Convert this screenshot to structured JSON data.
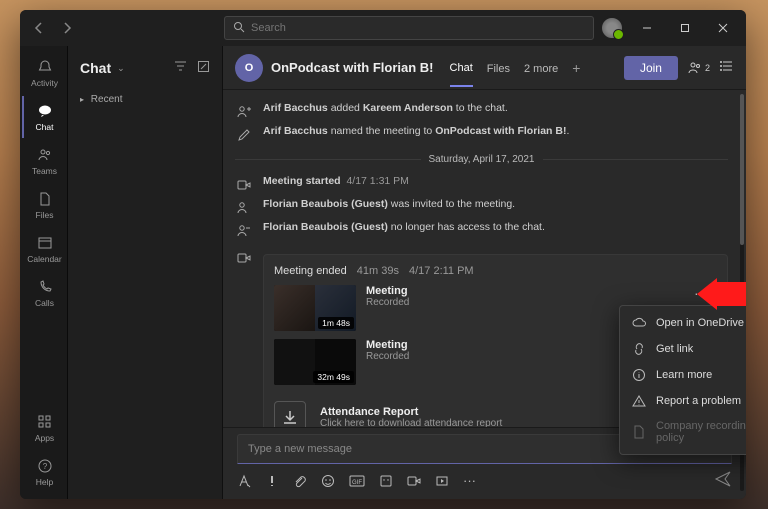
{
  "search": {
    "placeholder": "Search"
  },
  "rail": [
    {
      "label": "Activity",
      "icon": "bell"
    },
    {
      "label": "Chat",
      "icon": "chat"
    },
    {
      "label": "Teams",
      "icon": "people"
    },
    {
      "label": "Files",
      "icon": "file"
    },
    {
      "label": "Calendar",
      "icon": "calendar"
    },
    {
      "label": "Calls",
      "icon": "phone"
    }
  ],
  "rail_bottom": [
    {
      "label": "Apps",
      "icon": "apps"
    },
    {
      "label": "Help",
      "icon": "help"
    }
  ],
  "left_panel": {
    "title": "Chat",
    "recent": "Recent"
  },
  "chat": {
    "avatar_initial": "O",
    "title": "OnPodcast with Florian B!",
    "tabs": {
      "chat": "Chat",
      "files": "Files",
      "more": "2 more"
    },
    "join": "Join",
    "people_count": "2"
  },
  "sys": {
    "line1_a": "Arif Bacchus",
    "line1_b": " added ",
    "line1_c": "Kareem Anderson",
    "line1_d": " to the chat.",
    "line2_a": "Arif Bacchus",
    "line2_b": " named the meeting to ",
    "line2_c": "OnPodcast with Florian B!",
    "line2_d": ".",
    "date": "Saturday, April 17, 2021",
    "started": "Meeting started",
    "started_time": "4/17 1:31 PM",
    "invited": "Florian Beaubois (Guest)",
    "invited_suffix": " was invited to the meeting.",
    "noaccess": "Florian Beaubois (Guest)",
    "noaccess_suffix": " no longer has access to the chat."
  },
  "ended": {
    "title": "Meeting ended",
    "dur": "41m 39s",
    "time": "4/17 2:11 PM",
    "rec1": {
      "name": "Meeting",
      "sub": "Recorded",
      "len": "1m 48s"
    },
    "rec2": {
      "name": "Meeting",
      "sub": "Recorded",
      "len": "32m 49s"
    },
    "att": {
      "title": "Attendance Report",
      "sub": "Click here to download attendance report"
    }
  },
  "ctx": {
    "open": "Open in OneDrive",
    "link": "Get link",
    "learn": "Learn more",
    "report": "Report a problem",
    "policy": "Company recording policy"
  },
  "composer": {
    "placeholder": "Type a new message"
  }
}
